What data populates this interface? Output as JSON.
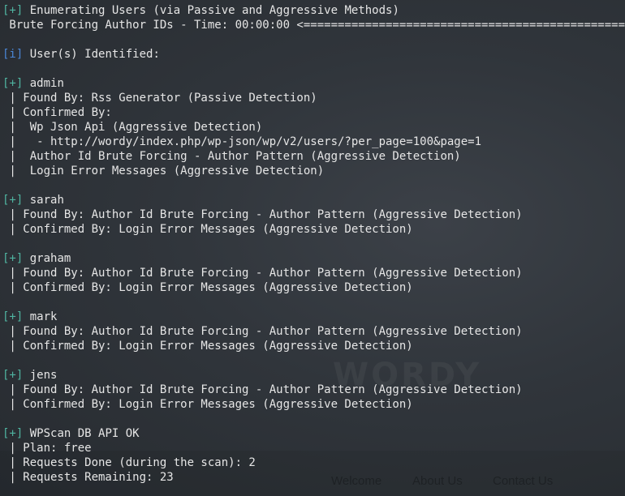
{
  "background": {
    "logo_text": "WORDY",
    "tagline_text": "...",
    "nav": [
      "Welcome",
      "About Us",
      "Contact Us"
    ]
  },
  "colors": {
    "plus_tag": "#4fb3a0",
    "info_tag": "#4a86d6",
    "text": "#e6e6e6"
  },
  "lines": [
    {
      "tag": "[+]",
      "tag_type": "plus",
      "text": " Enumerating Users (via Passive and Aggressive Methods)"
    },
    {
      "tag": "",
      "tag_type": "",
      "text": " Brute Forcing Author IDs - Time: 00:00:00 <=========================================================="
    },
    {
      "tag": "",
      "tag_type": "",
      "text": ""
    },
    {
      "tag": "[i]",
      "tag_type": "info",
      "text": " User(s) Identified:"
    },
    {
      "tag": "",
      "tag_type": "",
      "text": ""
    },
    {
      "tag": "[+]",
      "tag_type": "plus",
      "text": " admin"
    },
    {
      "tag": "",
      "tag_type": "",
      "text": " | Found By: Rss Generator (Passive Detection)"
    },
    {
      "tag": "",
      "tag_type": "",
      "text": " | Confirmed By:"
    },
    {
      "tag": "",
      "tag_type": "",
      "text": " |  Wp Json Api (Aggressive Detection)"
    },
    {
      "tag": "",
      "tag_type": "",
      "text": " |   - http://wordy/index.php/wp-json/wp/v2/users/?per_page=100&page=1"
    },
    {
      "tag": "",
      "tag_type": "",
      "text": " |  Author Id Brute Forcing - Author Pattern (Aggressive Detection)"
    },
    {
      "tag": "",
      "tag_type": "",
      "text": " |  Login Error Messages (Aggressive Detection)"
    },
    {
      "tag": "",
      "tag_type": "",
      "text": ""
    },
    {
      "tag": "[+]",
      "tag_type": "plus",
      "text": " sarah"
    },
    {
      "tag": "",
      "tag_type": "",
      "text": " | Found By: Author Id Brute Forcing - Author Pattern (Aggressive Detection)"
    },
    {
      "tag": "",
      "tag_type": "",
      "text": " | Confirmed By: Login Error Messages (Aggressive Detection)"
    },
    {
      "tag": "",
      "tag_type": "",
      "text": ""
    },
    {
      "tag": "[+]",
      "tag_type": "plus",
      "text": " graham"
    },
    {
      "tag": "",
      "tag_type": "",
      "text": " | Found By: Author Id Brute Forcing - Author Pattern (Aggressive Detection)"
    },
    {
      "tag": "",
      "tag_type": "",
      "text": " | Confirmed By: Login Error Messages (Aggressive Detection)"
    },
    {
      "tag": "",
      "tag_type": "",
      "text": ""
    },
    {
      "tag": "[+]",
      "tag_type": "plus",
      "text": " mark"
    },
    {
      "tag": "",
      "tag_type": "",
      "text": " | Found By: Author Id Brute Forcing - Author Pattern (Aggressive Detection)"
    },
    {
      "tag": "",
      "tag_type": "",
      "text": " | Confirmed By: Login Error Messages (Aggressive Detection)"
    },
    {
      "tag": "",
      "tag_type": "",
      "text": ""
    },
    {
      "tag": "[+]",
      "tag_type": "plus",
      "text": " jens"
    },
    {
      "tag": "",
      "tag_type": "",
      "text": " | Found By: Author Id Brute Forcing - Author Pattern (Aggressive Detection)"
    },
    {
      "tag": "",
      "tag_type": "",
      "text": " | Confirmed By: Login Error Messages (Aggressive Detection)"
    },
    {
      "tag": "",
      "tag_type": "",
      "text": ""
    },
    {
      "tag": "[+]",
      "tag_type": "plus",
      "text": " WPScan DB API OK"
    },
    {
      "tag": "",
      "tag_type": "",
      "text": " | Plan: free"
    },
    {
      "tag": "",
      "tag_type": "",
      "text": " | Requests Done (during the scan): 2"
    },
    {
      "tag": "",
      "tag_type": "",
      "text": " | Requests Remaining: 23"
    }
  ]
}
